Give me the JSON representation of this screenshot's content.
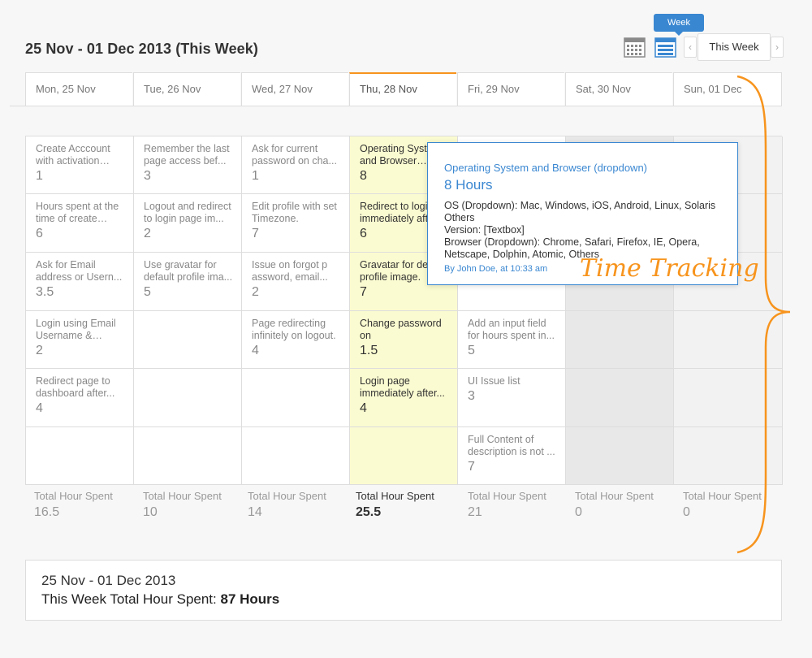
{
  "page_title": "25 Nov - 01 Dec 2013 (This Week)",
  "toolbar": {
    "view_tooltip": "Week",
    "prev_arrow": "‹",
    "next_arrow": "›",
    "this_week_label": "This Week",
    "icons": [
      "calendar-month-icon",
      "calendar-week-icon"
    ]
  },
  "days": [
    {
      "label": "Mon, 25 Nov",
      "total_label": "Total Hour Spent",
      "total": "16.5",
      "tasks": [
        {
          "title": "Create Acccount with activation email.",
          "hours": "1"
        },
        {
          "title": "Hours spent at the time of create task...",
          "hours": "6"
        },
        {
          "title": "Ask for Email address or Usern...",
          "hours": "3.5"
        },
        {
          "title": "Login using Email Username & Reme...",
          "hours": "2"
        },
        {
          "title": "Redirect page to dashboard after...",
          "hours": "4"
        }
      ]
    },
    {
      "label": "Tue, 26 Nov",
      "total_label": "Total Hour Spent",
      "total": "10",
      "tasks": [
        {
          "title": "Remember the last page access bef...",
          "hours": "3"
        },
        {
          "title": "Logout and redirect to login page im...",
          "hours": "2"
        },
        {
          "title": "Use gravatar for default profile ima...",
          "hours": "5"
        }
      ]
    },
    {
      "label": "Wed, 27 Nov",
      "total_label": "Total Hour Spent",
      "total": "14",
      "tasks": [
        {
          "title": "Ask for current password on cha...",
          "hours": "1"
        },
        {
          "title": "Edit profile with set Timezone.",
          "hours": "7"
        },
        {
          "title": "Issue on forgot p assword, email...",
          "hours": "2"
        },
        {
          "title": "Page redirecting infinitely on logout.",
          "hours": "4"
        }
      ]
    },
    {
      "label": "Thu, 28 Nov",
      "total_label": "Total Hour Spent",
      "total": "25.5",
      "tasks": [
        {
          "title": "Operating System and Browser (dropdown)",
          "hours": "8"
        },
        {
          "title": "Redirect to login immediately after",
          "hours": "6"
        },
        {
          "title": "Gravatar for default profile image.",
          "hours": "7"
        },
        {
          "title": "Change password on",
          "hours": "1.5"
        },
        {
          "title": "Login page immediately after...",
          "hours": "4"
        }
      ]
    },
    {
      "label": "Fri, 29 Nov",
      "total_label": "Total Hour Spent",
      "total": "21",
      "tasks": [
        {
          "title": "",
          "hours": ""
        },
        {
          "title": "",
          "hours": ""
        },
        {
          "title": "",
          "hours": ""
        },
        {
          "title": "Add an input field for hours spent in...",
          "hours": "5"
        },
        {
          "title": "UI Issue list",
          "hours": "3"
        },
        {
          "title": "Full Content of description is not ...",
          "hours": "7"
        }
      ]
    },
    {
      "label": "Sat, 30 Nov",
      "total_label": "Total Hour Spent",
      "total": "0",
      "tasks": []
    },
    {
      "label": "Sun, 01 Dec",
      "total_label": "Total Hour Spent",
      "total": "0",
      "tasks": []
    }
  ],
  "popover": {
    "title": "Operating System and Browser (dropdown)",
    "hours": "8 Hours",
    "lines": [
      "OS (Dropdown): Mac, Windows, iOS, Android, Linux, Solaris Others",
      "Version: [Textbox]",
      "Browser (Dropdown): Chrome, Safari, Firefox, IE, Opera, Netscape, Dolphin, Atomic, Others"
    ],
    "byline": "By John Doe, at 10:33 am"
  },
  "annotation": "Time Tracking",
  "summary": {
    "range": "25 Nov - 01 Dec 2013",
    "total_prefix": "This Week Total Hour Spent:",
    "total_value": "87 Hours"
  },
  "colors": {
    "accent": "#f7941d",
    "link": "#3a87d1",
    "today": "#fbfbd1"
  }
}
